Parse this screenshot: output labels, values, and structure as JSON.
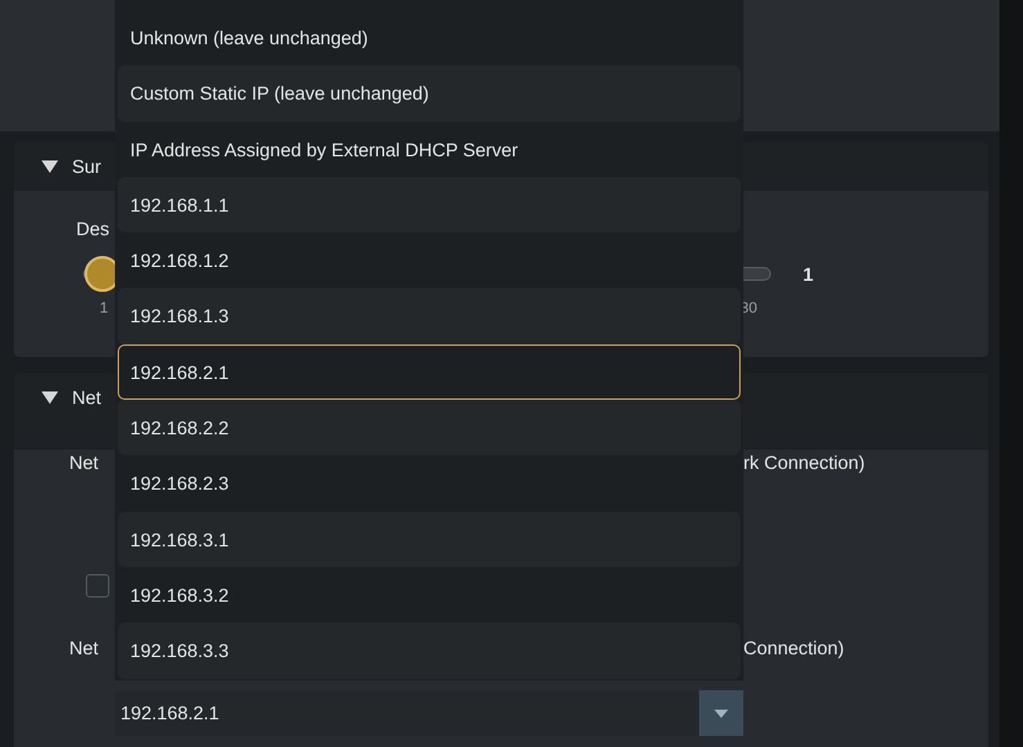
{
  "sections": [
    {
      "title": "Sur",
      "expanded": true,
      "label": "Des",
      "slider": {
        "level": 0,
        "min_label": "1",
        "max_label": "30",
        "reading": "1"
      }
    },
    {
      "title": "Net",
      "expanded": true,
      "rows": [
        {
          "kind": "value",
          "label": "Net",
          "value": "rk Connection)"
        },
        {
          "kind": "checkbox",
          "checked": false
        },
        {
          "kind": "value",
          "label": "Net",
          "value": "Connection)"
        },
        {
          "kind": "dropdown",
          "value": "192.168.2.1"
        }
      ]
    }
  ],
  "popup_options": [
    {
      "label": "Unknown (leave unchanged)",
      "selected": false
    },
    {
      "label": "Custom Static IP (leave unchanged)",
      "selected": false
    },
    {
      "label": "IP Address Assigned by External DHCP Server",
      "selected": false
    },
    {
      "label": "192.168.1.1",
      "selected": false
    },
    {
      "label": "192.168.1.2",
      "selected": false
    },
    {
      "label": "192.168.1.3",
      "selected": false
    },
    {
      "label": "192.168.2.1",
      "selected": true
    },
    {
      "label": "192.168.2.2",
      "selected": false
    },
    {
      "label": "192.168.2.3",
      "selected": false
    },
    {
      "label": "192.168.3.1",
      "selected": false
    },
    {
      "label": "192.168.3.2",
      "selected": false
    },
    {
      "label": "192.168.3.3",
      "selected": false
    }
  ]
}
